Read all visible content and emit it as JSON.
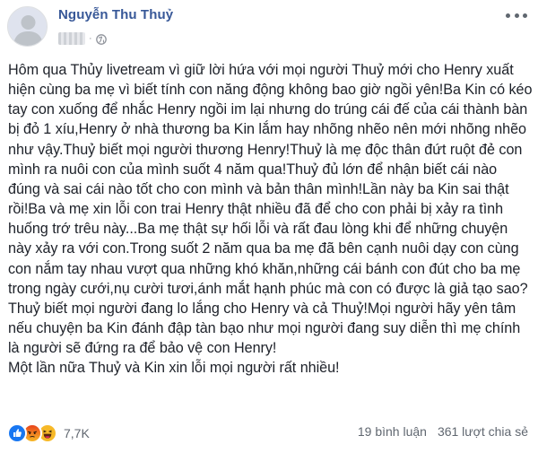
{
  "post": {
    "author": "Nguyễn Thu Thuỷ",
    "dot_separator": "·",
    "paragraphs": [
      "Hôm qua Thủy livetream vì giữ lời hứa với mọi người Thuỷ mới cho Henry xuất hiện cùng ba mẹ vì biết tính con năng động không bao giờ ngồi yên!Ba Kin có kéo tay con xuống để nhắc Henry ngồi im lại nhưng do trúng cái đế của cái thành bàn bị đỏ 1 xíu,Henry ở nhà thương ba Kin lắm hay nhõng nhẽo nên mới nhõng nhẽo như vậy.Thuỷ biết mọi người thương Henry!Thuỷ là mẹ độc thân đứt ruột đẻ con mình ra nuôi con của mình suốt 4 năm qua!Thuỷ đủ lớn để nhận biết cái nào đúng và sai cái nào tốt cho con mình và bản thân mình!Lần này ba Kin sai thật rồi!Ba và mẹ xin lỗi con trai Henry thật nhiều đã để cho con phải bị xảy ra tình huống trớ trêu này...Ba mẹ thật sự hối lỗi và rất đau lòng khi để những chuyện này xảy ra với con.Trong suốt 2 năm qua ba mẹ đã bên cạnh nuôi dạy con cùng con nắm tay nhau vượt qua những khó khăn,những cái bánh con đút cho ba mẹ trong ngày cưới,nụ cười tươi,ánh mắt hạnh phúc mà con có được là giả tạo sao?Thuỷ biết mọi người đang lo lắng cho Henry và cả Thuỷ!Mọi người hãy yên tâm nếu chuyện ba Kin đánh đập tàn bạo như mọi người đang suy diễn thì mẹ chính là người sẽ đứng ra để bảo vệ con Henry!",
      "Một lần nữa Thuỷ và Kin xin lỗi mọi người rất nhiều!"
    ]
  },
  "footer": {
    "reaction_count": "7,7K",
    "comments": "19 bình luận",
    "shares": "361 lượt chia sẻ"
  },
  "icons": {
    "reactions": [
      "like-icon",
      "angry-icon",
      "haha-icon"
    ],
    "privacy": "globe-icon",
    "menu": "more-options-icon"
  },
  "colors": {
    "author_link": "#385898",
    "text": "#1d2129",
    "secondary_text": "#606770",
    "like_blue": "#1877f2",
    "angry_orange": "#f25c19",
    "haha_yellow": "#f7b928"
  }
}
